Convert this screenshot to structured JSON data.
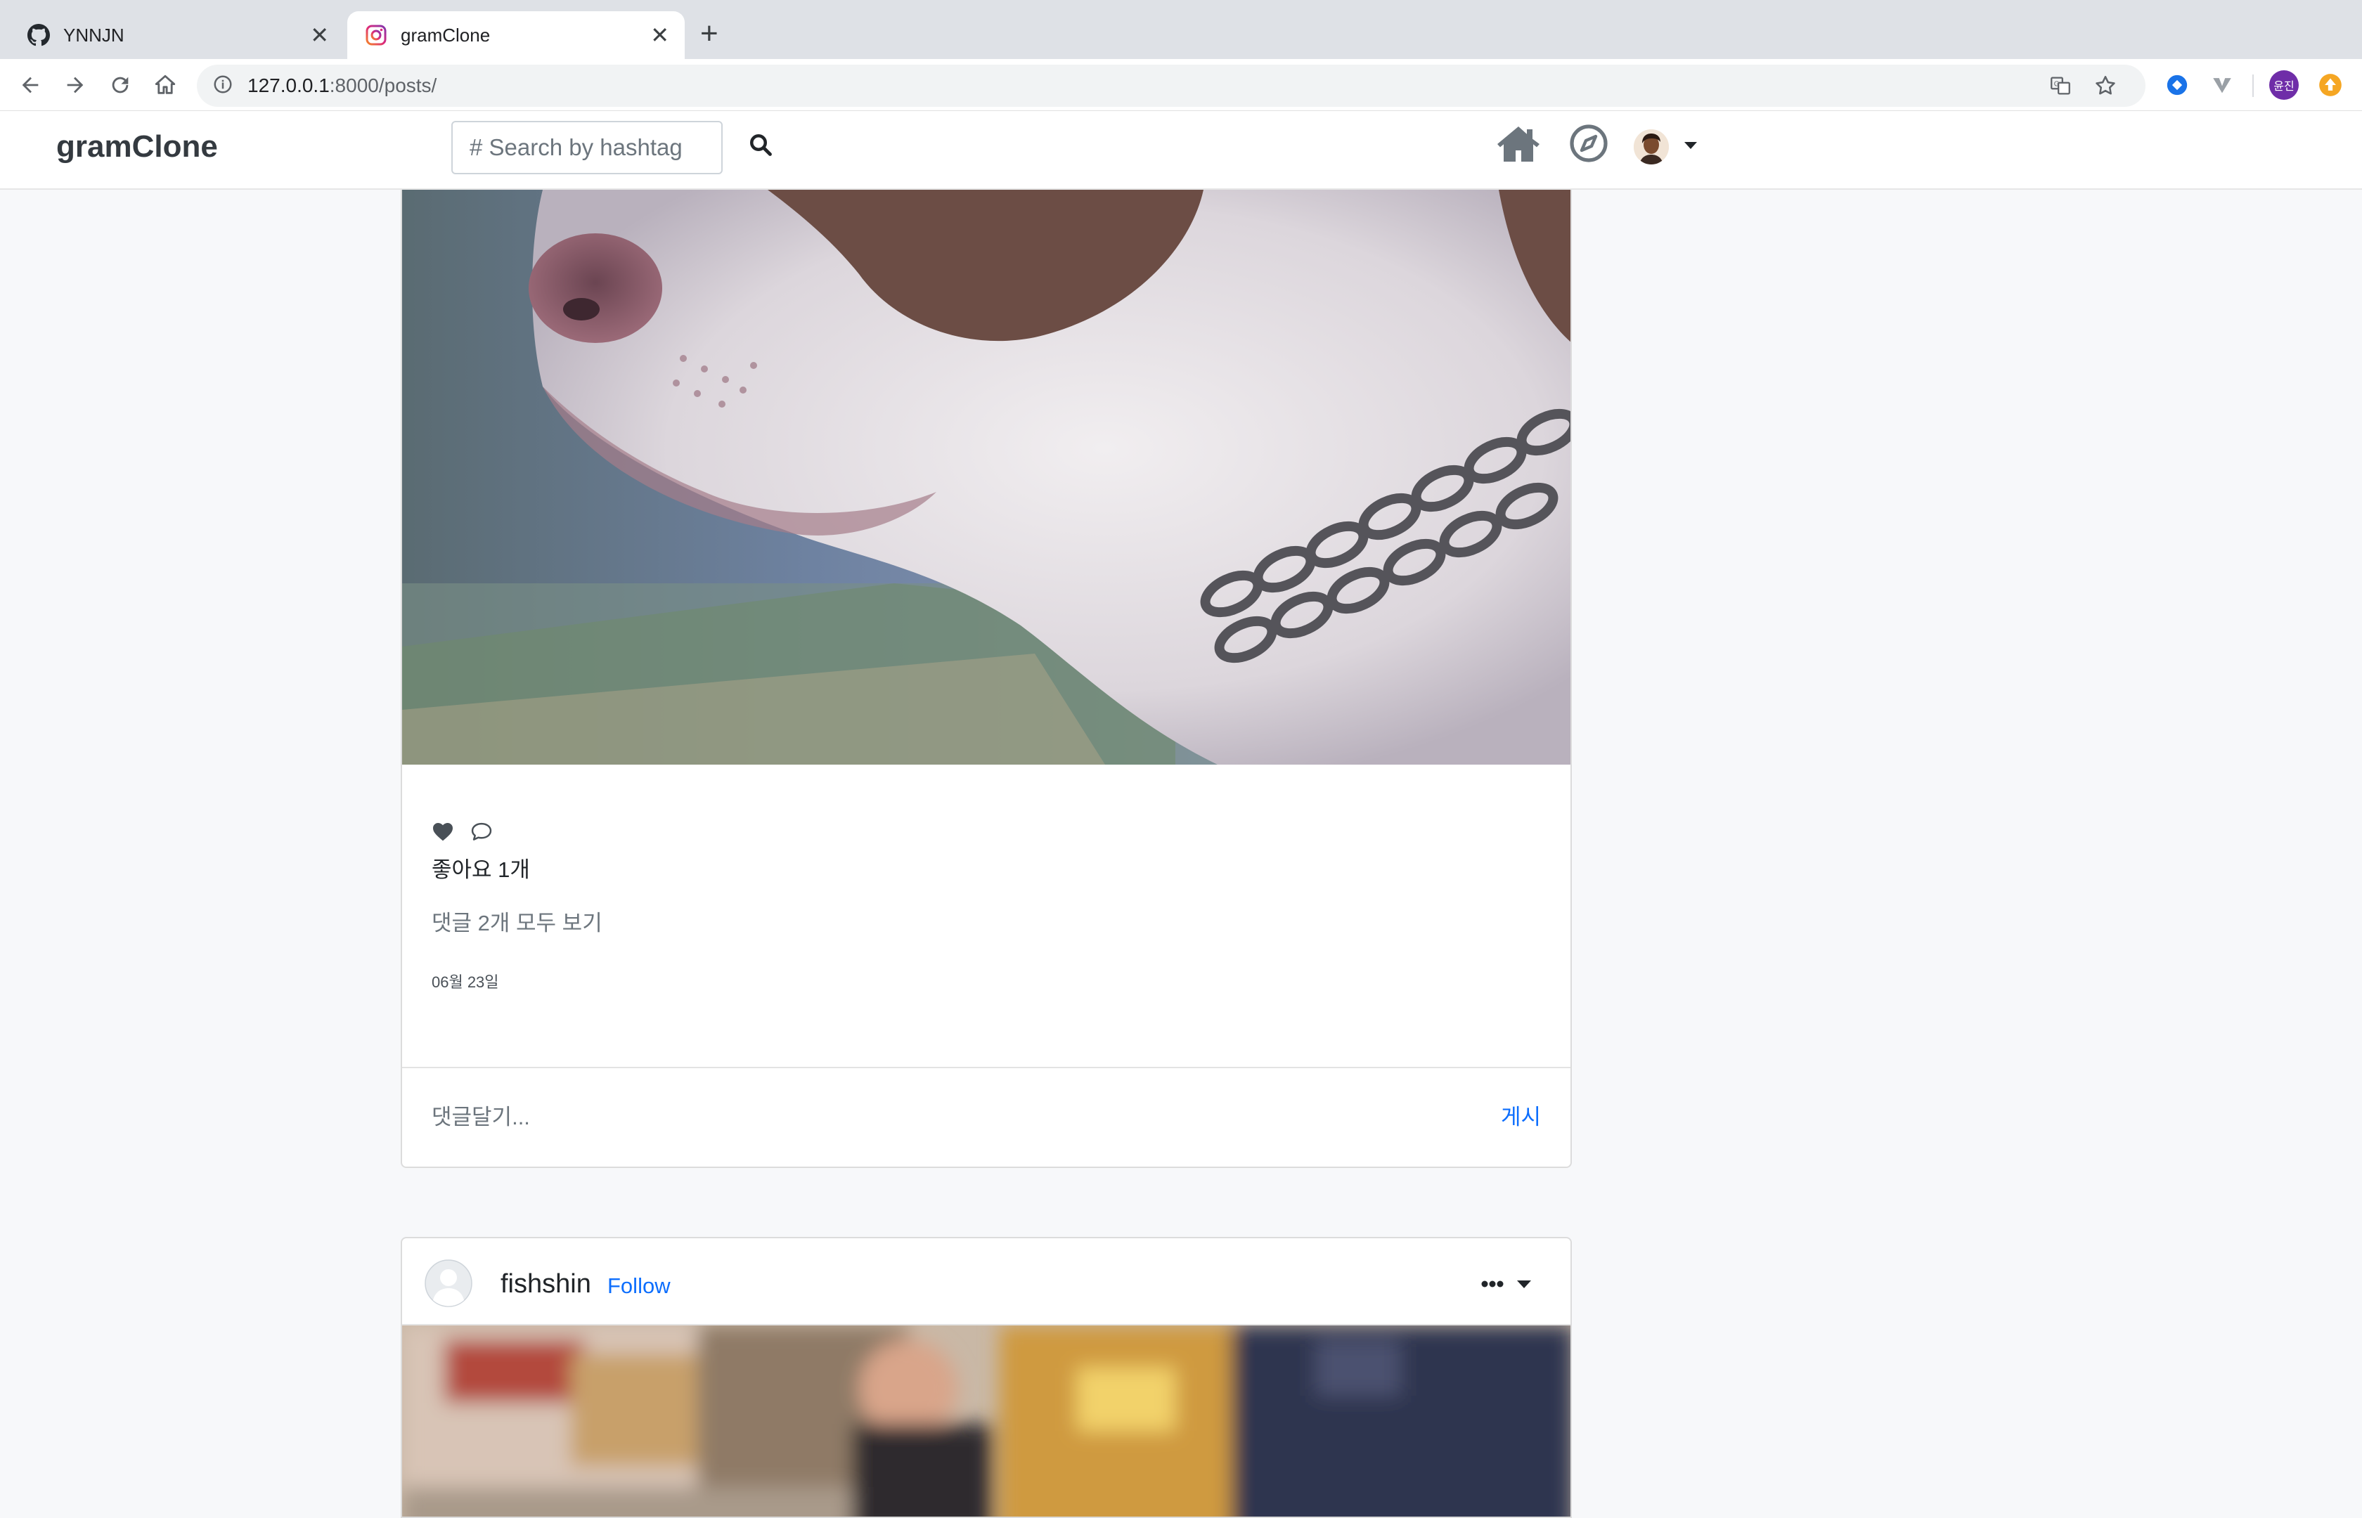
{
  "browser": {
    "tabs": [
      {
        "title": "YNNJN",
        "active": false
      },
      {
        "title": "gramClone",
        "active": true
      }
    ],
    "url_host": "127.0.0.1",
    "url_rest": ":8000/posts/",
    "profile_badge": "윤진"
  },
  "site": {
    "brand": "gramClone",
    "search_placeholder": "# Search by hashtag"
  },
  "post1": {
    "likes": "좋아요 1개",
    "view_comments": "댓글 2개 모두 보기",
    "date": "06월 23일",
    "comment_placeholder": "댓글달기...",
    "post_button": "게시"
  },
  "post2": {
    "username": "fishshin",
    "follow": "Follow"
  },
  "colors": {
    "accent": "#0d6efd",
    "nav_icon": "#6c757d"
  }
}
